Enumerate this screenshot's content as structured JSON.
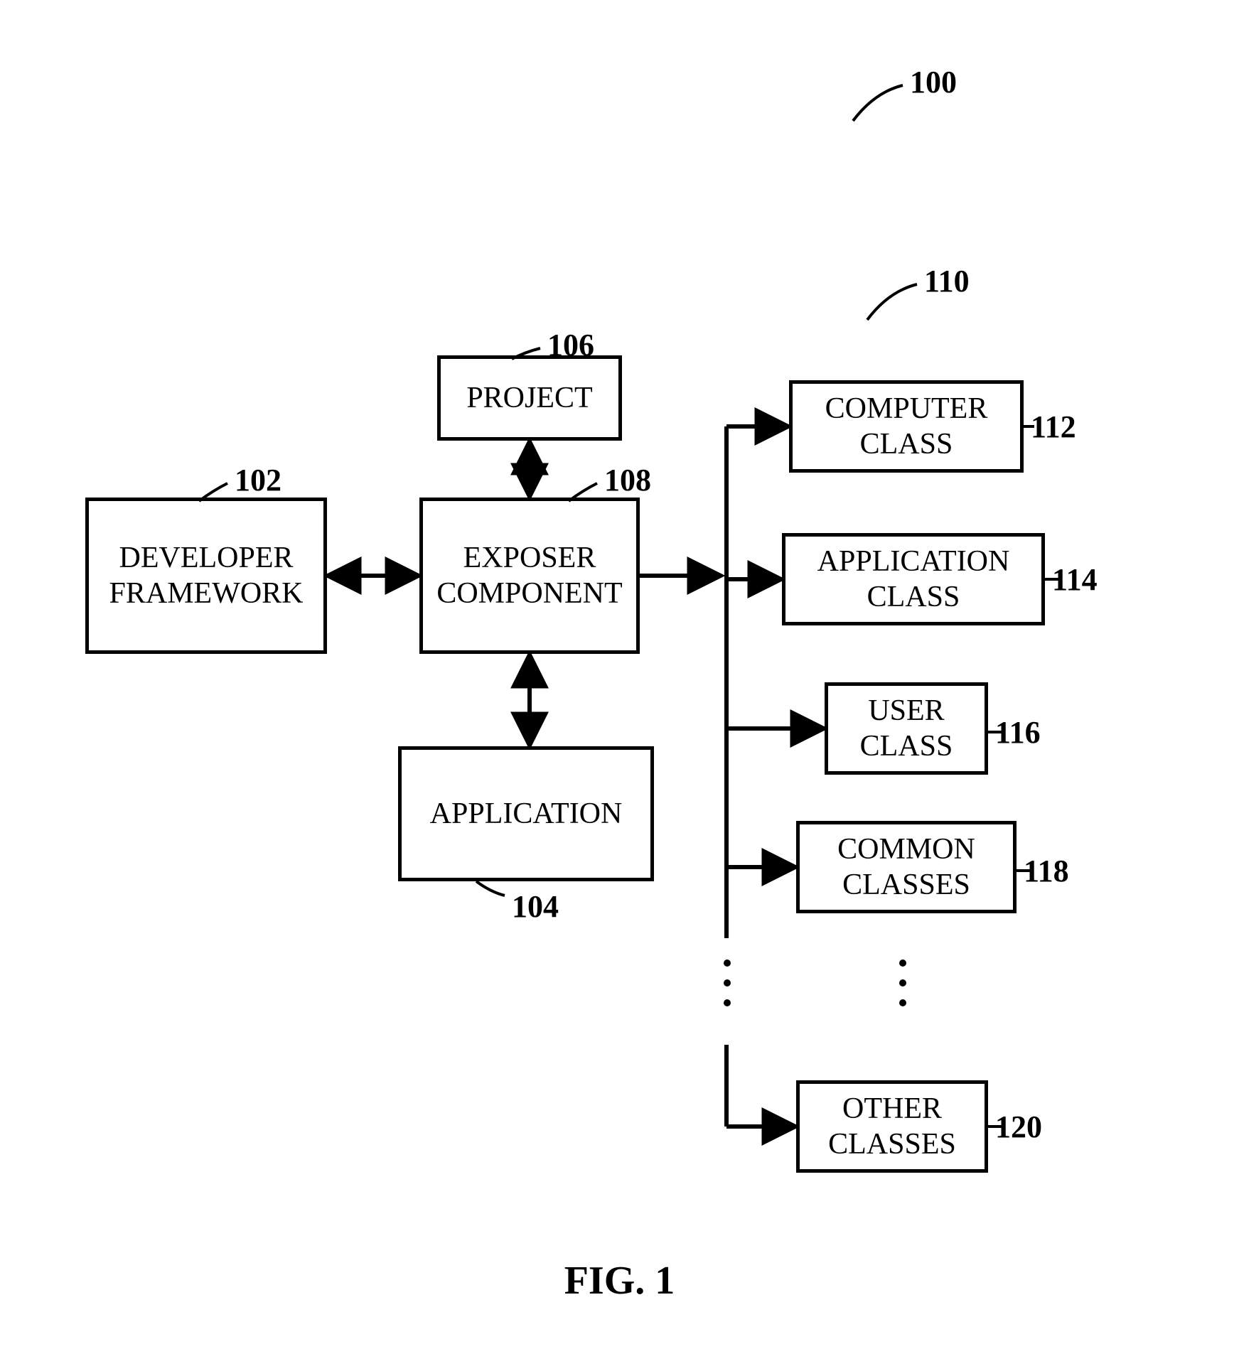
{
  "figure_label": "FIG. 1",
  "refs": {
    "r100": "100",
    "r102": "102",
    "r104": "104",
    "r106": "106",
    "r108": "108",
    "r110": "110",
    "r112": "112",
    "r114": "114",
    "r116": "116",
    "r118": "118",
    "r120": "120"
  },
  "boxes": {
    "developer_framework": "DEVELOPER FRAMEWORK",
    "project": "PROJECT",
    "exposer_component": "EXPOSER COMPONENT",
    "application": "APPLICATION",
    "computer_class": "COMPUTER CLASS",
    "application_class": "APPLICATION CLASS",
    "user_class": "USER CLASS",
    "common_classes": "COMMON CLASSES",
    "other_classes": "OTHER CLASSES"
  }
}
